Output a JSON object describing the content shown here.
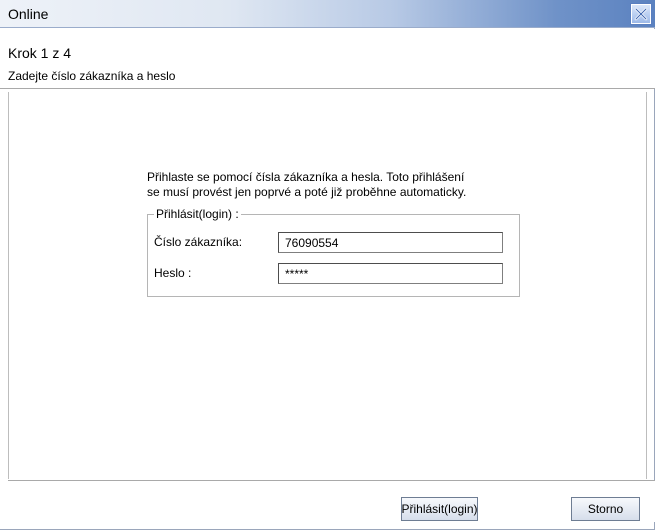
{
  "window": {
    "title": "Online"
  },
  "header": {
    "step": "Krok 1 z 4",
    "subtitle": "Zadejte číslo zákazníka a heslo"
  },
  "intro": {
    "line1": "Přihlaste se pomocí čísla zákazníka a hesla. Toto přihlášení",
    "line2": "se musí provést jen poprvé a poté již proběhne automaticky."
  },
  "login_group": {
    "legend": "Přihlásit(login) :",
    "customer_label": "Číslo zákazníka:",
    "customer_value": "76090554",
    "password_label": "Heslo :",
    "password_value": "*****"
  },
  "footer": {
    "login_button": "Přihlásit(login)",
    "cancel_button": "Storno"
  },
  "icons": {
    "close": "close-icon"
  }
}
